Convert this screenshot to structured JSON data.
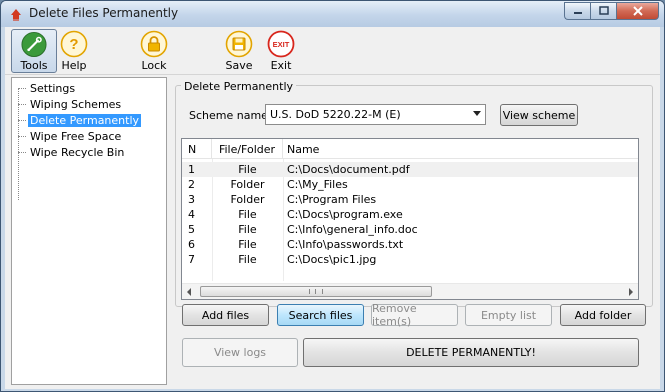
{
  "window": {
    "title": "Delete Files Permanently"
  },
  "toolbar": {
    "tools": "Tools",
    "help": "Help",
    "lock": "Lock",
    "save": "Save",
    "exit": "Exit",
    "exit_icon_text": "EXIT",
    "help_icon_text": "?"
  },
  "sidebar": {
    "items": [
      {
        "label": "Settings"
      },
      {
        "label": "Wiping Schemes"
      },
      {
        "label": "Delete Permanently"
      },
      {
        "label": "Wipe Free Space"
      },
      {
        "label": "Wipe Recycle Bin"
      }
    ],
    "selected": "Delete Permanently"
  },
  "panel": {
    "group_title": "Delete Permanently",
    "scheme_label": "Scheme name",
    "scheme_value": "U.S. DoD 5220.22-M (E)",
    "view_scheme": "View scheme"
  },
  "table": {
    "headers": [
      "N",
      "File/Folder",
      "Name"
    ],
    "rows": [
      {
        "n": "1",
        "type": "File",
        "name": "C:\\Docs\\document.pdf"
      },
      {
        "n": "2",
        "type": "Folder",
        "name": "C:\\My_Files"
      },
      {
        "n": "3",
        "type": "Folder",
        "name": "C:\\Program Files"
      },
      {
        "n": "4",
        "type": "File",
        "name": "C:\\Docs\\program.exe"
      },
      {
        "n": "5",
        "type": "File",
        "name": "C:\\Info\\general_info.doc"
      },
      {
        "n": "6",
        "type": "File",
        "name": "C:\\Info\\passwords.txt"
      },
      {
        "n": "7",
        "type": "File",
        "name": "C:\\Docs\\pic1.jpg"
      }
    ]
  },
  "actions": {
    "add_files": "Add files",
    "search_files": "Search files",
    "remove_items": "Remove item(s)",
    "empty_list": "Empty list",
    "add_folder": "Add folder",
    "view_logs": "View logs",
    "delete_permanently": "DELETE PERMANENTLY!"
  },
  "colors": {
    "selection": "#3399ff",
    "exit_red": "#d8261c",
    "lock_gold": "#f0b400"
  }
}
